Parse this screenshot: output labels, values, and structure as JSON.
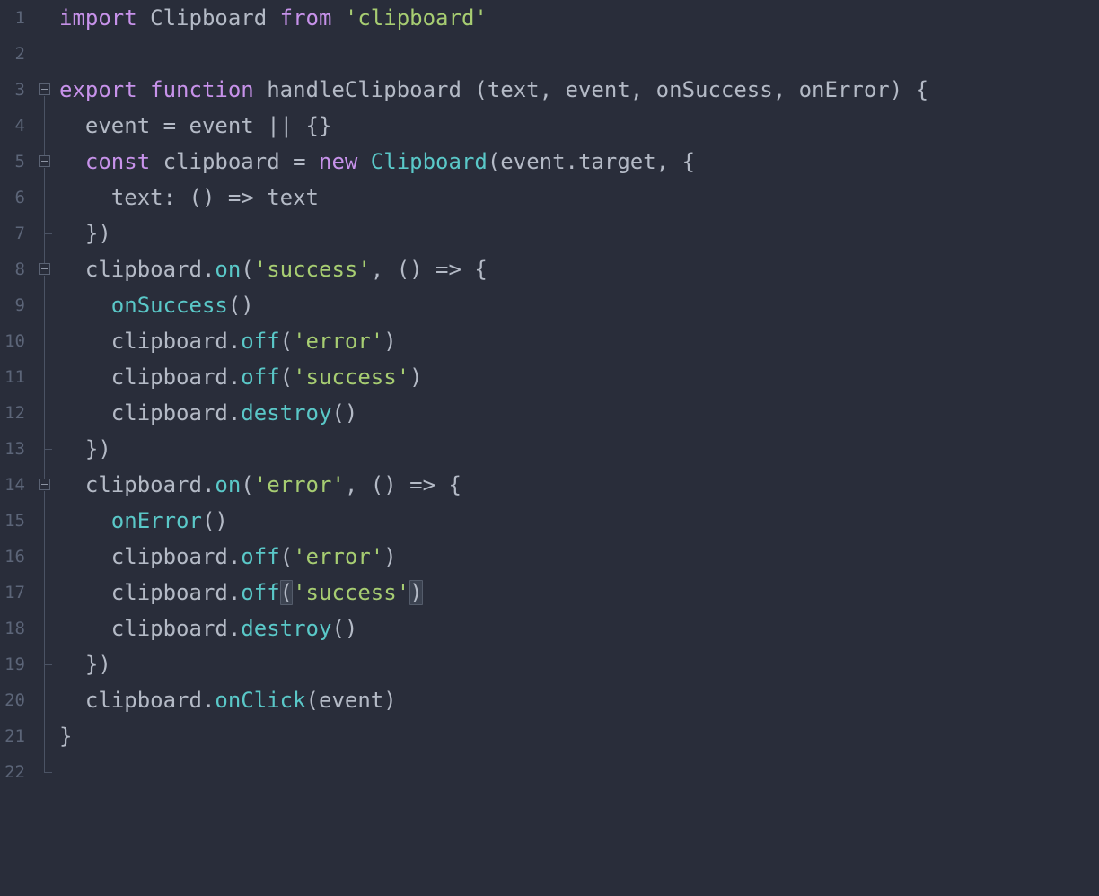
{
  "editor": {
    "language": "javascript",
    "background_color": "#292d3a",
    "line_number_color": "#5c6578",
    "total_lines": 22,
    "indent_guide_color": "#4b5364",
    "bracket_match_background": "#3b4250",
    "palette": {
      "plain": "#b4bac6",
      "keyword": "#c792ea",
      "class": "#5ac8c8",
      "method": "#5ac8c8",
      "string": "#a7cd72"
    },
    "lines": [
      {
        "number": "1",
        "gutter": "none",
        "tokens": [
          {
            "text": "import ",
            "type": "keyword"
          },
          {
            "text": "Clipboard ",
            "type": "plain"
          },
          {
            "text": "from ",
            "type": "keyword"
          },
          {
            "text": "'clipboard'",
            "type": "string"
          }
        ]
      },
      {
        "number": "2",
        "gutter": "none",
        "tokens": []
      },
      {
        "number": "3",
        "gutter": "fold-open",
        "tokens": [
          {
            "text": "export function ",
            "type": "keyword"
          },
          {
            "text": "handleClipboard (text, event, onSuccess, onError) {",
            "type": "plain"
          }
        ]
      },
      {
        "number": "4",
        "gutter": "guide",
        "tokens": [
          {
            "text": "  event = event || {}",
            "type": "plain"
          }
        ]
      },
      {
        "number": "5",
        "gutter": "fold-open",
        "tokens": [
          {
            "text": "  ",
            "type": "plain"
          },
          {
            "text": "const ",
            "type": "keyword"
          },
          {
            "text": "clipboard = ",
            "type": "plain"
          },
          {
            "text": "new ",
            "type": "keyword"
          },
          {
            "text": "Clipboard",
            "type": "class"
          },
          {
            "text": "(event.target, {",
            "type": "plain"
          }
        ]
      },
      {
        "number": "6",
        "gutter": "guide",
        "tokens": [
          {
            "text": "    text: () => text",
            "type": "plain"
          }
        ]
      },
      {
        "number": "7",
        "gutter": "fold-end",
        "tokens": [
          {
            "text": "  })",
            "type": "plain"
          }
        ]
      },
      {
        "number": "8",
        "gutter": "fold-open",
        "tokens": [
          {
            "text": "  clipboard.",
            "type": "plain"
          },
          {
            "text": "on",
            "type": "method"
          },
          {
            "text": "(",
            "type": "punct"
          },
          {
            "text": "'success'",
            "type": "string"
          },
          {
            "text": ", () => {",
            "type": "plain"
          }
        ]
      },
      {
        "number": "9",
        "gutter": "guide",
        "tokens": [
          {
            "text": "    ",
            "type": "plain"
          },
          {
            "text": "onSuccess",
            "type": "method"
          },
          {
            "text": "()",
            "type": "plain"
          }
        ]
      },
      {
        "number": "10",
        "gutter": "guide",
        "tokens": [
          {
            "text": "    clipboard.",
            "type": "plain"
          },
          {
            "text": "off",
            "type": "method"
          },
          {
            "text": "(",
            "type": "punct"
          },
          {
            "text": "'error'",
            "type": "string"
          },
          {
            "text": ")",
            "type": "punct"
          }
        ]
      },
      {
        "number": "11",
        "gutter": "guide",
        "tokens": [
          {
            "text": "    clipboard.",
            "type": "plain"
          },
          {
            "text": "off",
            "type": "method"
          },
          {
            "text": "(",
            "type": "punct"
          },
          {
            "text": "'success'",
            "type": "string"
          },
          {
            "text": ")",
            "type": "punct"
          }
        ]
      },
      {
        "number": "12",
        "gutter": "guide",
        "tokens": [
          {
            "text": "    clipboard.",
            "type": "plain"
          },
          {
            "text": "destroy",
            "type": "method"
          },
          {
            "text": "()",
            "type": "plain"
          }
        ]
      },
      {
        "number": "13",
        "gutter": "fold-end",
        "tokens": [
          {
            "text": "  })",
            "type": "plain"
          }
        ]
      },
      {
        "number": "14",
        "gutter": "fold-open",
        "tokens": [
          {
            "text": "  clipboard.",
            "type": "plain"
          },
          {
            "text": "on",
            "type": "method"
          },
          {
            "text": "(",
            "type": "punct"
          },
          {
            "text": "'error'",
            "type": "string"
          },
          {
            "text": ", () => {",
            "type": "plain"
          }
        ]
      },
      {
        "number": "15",
        "gutter": "guide",
        "tokens": [
          {
            "text": "    ",
            "type": "plain"
          },
          {
            "text": "onError",
            "type": "method"
          },
          {
            "text": "()",
            "type": "plain"
          }
        ]
      },
      {
        "number": "16",
        "gutter": "guide",
        "tokens": [
          {
            "text": "    clipboard.",
            "type": "plain"
          },
          {
            "text": "off",
            "type": "method"
          },
          {
            "text": "(",
            "type": "punct"
          },
          {
            "text": "'error'",
            "type": "string"
          },
          {
            "text": ")",
            "type": "punct"
          }
        ]
      },
      {
        "number": "17",
        "gutter": "guide",
        "bracket_match": true,
        "tokens": [
          {
            "text": "    clipboard.",
            "type": "plain"
          },
          {
            "text": "off",
            "type": "method"
          },
          {
            "text": "(",
            "type": "punct",
            "match": true
          },
          {
            "text": "'success'",
            "type": "string"
          },
          {
            "text": ")",
            "type": "punct",
            "match": true
          }
        ]
      },
      {
        "number": "18",
        "gutter": "guide",
        "tokens": [
          {
            "text": "    clipboard.",
            "type": "plain"
          },
          {
            "text": "destroy",
            "type": "method"
          },
          {
            "text": "()",
            "type": "plain"
          }
        ]
      },
      {
        "number": "19",
        "gutter": "fold-end",
        "tokens": [
          {
            "text": "  })",
            "type": "plain"
          }
        ]
      },
      {
        "number": "20",
        "gutter": "guide",
        "tokens": [
          {
            "text": "  clipboard.",
            "type": "plain"
          },
          {
            "text": "onClick",
            "type": "method"
          },
          {
            "text": "(event)",
            "type": "plain"
          }
        ]
      },
      {
        "number": "21",
        "gutter": "guide",
        "tokens": [
          {
            "text": "}",
            "type": "plain"
          }
        ]
      },
      {
        "number": "22",
        "gutter": "fold-corner",
        "tokens": []
      }
    ]
  }
}
